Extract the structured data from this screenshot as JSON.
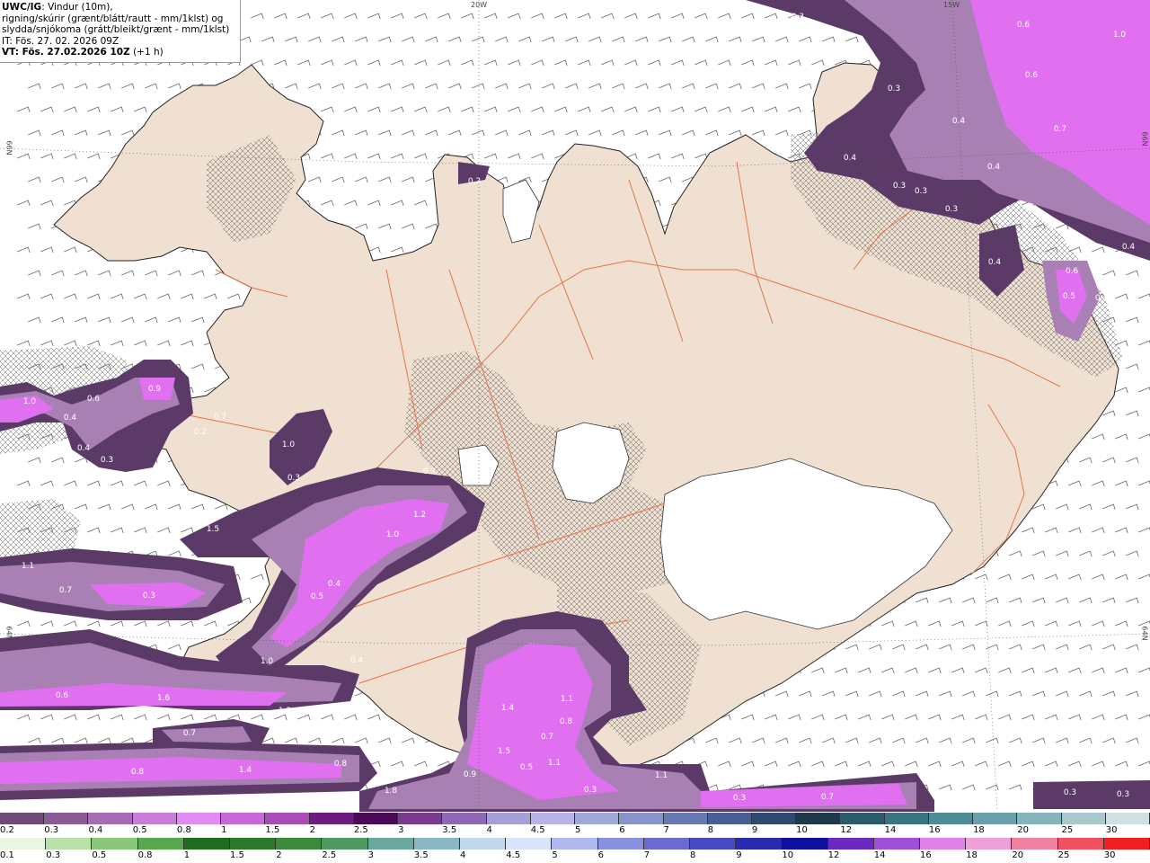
{
  "header": {
    "model": "UWC/IG",
    "desc_1": ": Vindur (10m),",
    "desc_2": "rigning/skúrir (grænt/blátt/rautt - mm/1klst) og",
    "desc_3": "slydda/snjókoma (grátt/bleikt/grænt - mm/1klst)",
    "issue_time": "IT: Fös. 27. 02. 2026 09Z",
    "valid_label": "VT: Fös. 27.02.2026 10Z",
    "valid_offset": " (+1 h)"
  },
  "grid_labels": {
    "lon_20w": "20W",
    "lon_15w": "15W",
    "lat_66n": "66N",
    "lat_64n": "64N"
  },
  "colors": {
    "land": "#efe0d2",
    "sea": "#ffffff",
    "roads": "#e8734a",
    "snow_light": "#a880b4",
    "snow_dark": "#5c3a68",
    "snow_pink": "#e070f0"
  },
  "precip_values": [
    "0.3",
    "0.6",
    "1.0",
    "0.3",
    "0.4",
    "0.7",
    "0.6",
    "0.4",
    "0.3",
    "0.3",
    "0.4",
    "0.3",
    "0.4",
    "0.4",
    "0.6",
    "0.5",
    "0.4",
    "0.3",
    "1.0",
    "0.6",
    "0.4",
    "0.9",
    "0.3",
    "0.4",
    "0.3",
    "0.2",
    "0.7",
    "0.3",
    "1.0",
    "1.5",
    "1.2",
    "1.0",
    "0.4",
    "0.5",
    "0.7",
    "1.1",
    "0.7",
    "0.3",
    "1.0",
    "0.4",
    "0.6",
    "1.6",
    "1.3",
    "0.7",
    "0.8",
    "1.4",
    "0.8",
    "1.8",
    "1.4",
    "1.1",
    "1.5",
    "0.7",
    "0.5",
    "1.1",
    "0.9",
    "1.1",
    "0.3",
    "0.3",
    "0.7",
    "0.3",
    "0.3",
    "0.2",
    "0.8"
  ],
  "legend": {
    "snow": {
      "labels": [
        "0.2",
        "0.3",
        "0.4",
        "0.5",
        "0.8",
        "1",
        "1.5",
        "2",
        "2.5",
        "3",
        "3.5",
        "4",
        "4.5",
        "5",
        "6",
        "7",
        "8",
        "9",
        "10",
        "12",
        "14",
        "16",
        "18",
        "20",
        "25",
        "30"
      ],
      "colors": [
        "#6e4a78",
        "#8a5c96",
        "#a66cb4",
        "#c87ed8",
        "#e08cf0",
        "#c868d8",
        "#a84cb8",
        "#6c1c7c",
        "#4a0a58",
        "#7a3a8e",
        "#8e68b4",
        "#a6a0d8",
        "#b8b4e8",
        "#a0a8d8",
        "#8894c8",
        "#6878b0",
        "#4a5e94",
        "#2e4a70",
        "#1e3a4a",
        "#2a5c6c",
        "#3a7480",
        "#508c98",
        "#6aa0aa",
        "#86b4bc",
        "#a8c8cc",
        "#d0e0e2"
      ]
    },
    "rain": {
      "labels": [
        "0.1",
        "0.3",
        "0.5",
        "0.8",
        "1",
        "1.5",
        "2",
        "2.5",
        "3",
        "3.5",
        "4",
        "4.5",
        "5",
        "6",
        "7",
        "8",
        "9",
        "10",
        "12",
        "14",
        "16",
        "18",
        "20",
        "25",
        "30"
      ],
      "colors": [
        "#e8f8e0",
        "#b8e0a8",
        "#88c878",
        "#58a850",
        "#1e6e1e",
        "#2a7a2a",
        "#3c8a3c",
        "#4e9a60",
        "#6aa8a0",
        "#88b8c0",
        "#c0d8e8",
        "#d8e4f8",
        "#b0b8f0",
        "#8a90e0",
        "#6a6ad0",
        "#4848c0",
        "#2a2ab0",
        "#1010a0",
        "#6a2ac0",
        "#a050d8",
        "#e080e8",
        "#f0a0d8",
        "#f080a0",
        "#f05060",
        "#f02020"
      ]
    }
  }
}
